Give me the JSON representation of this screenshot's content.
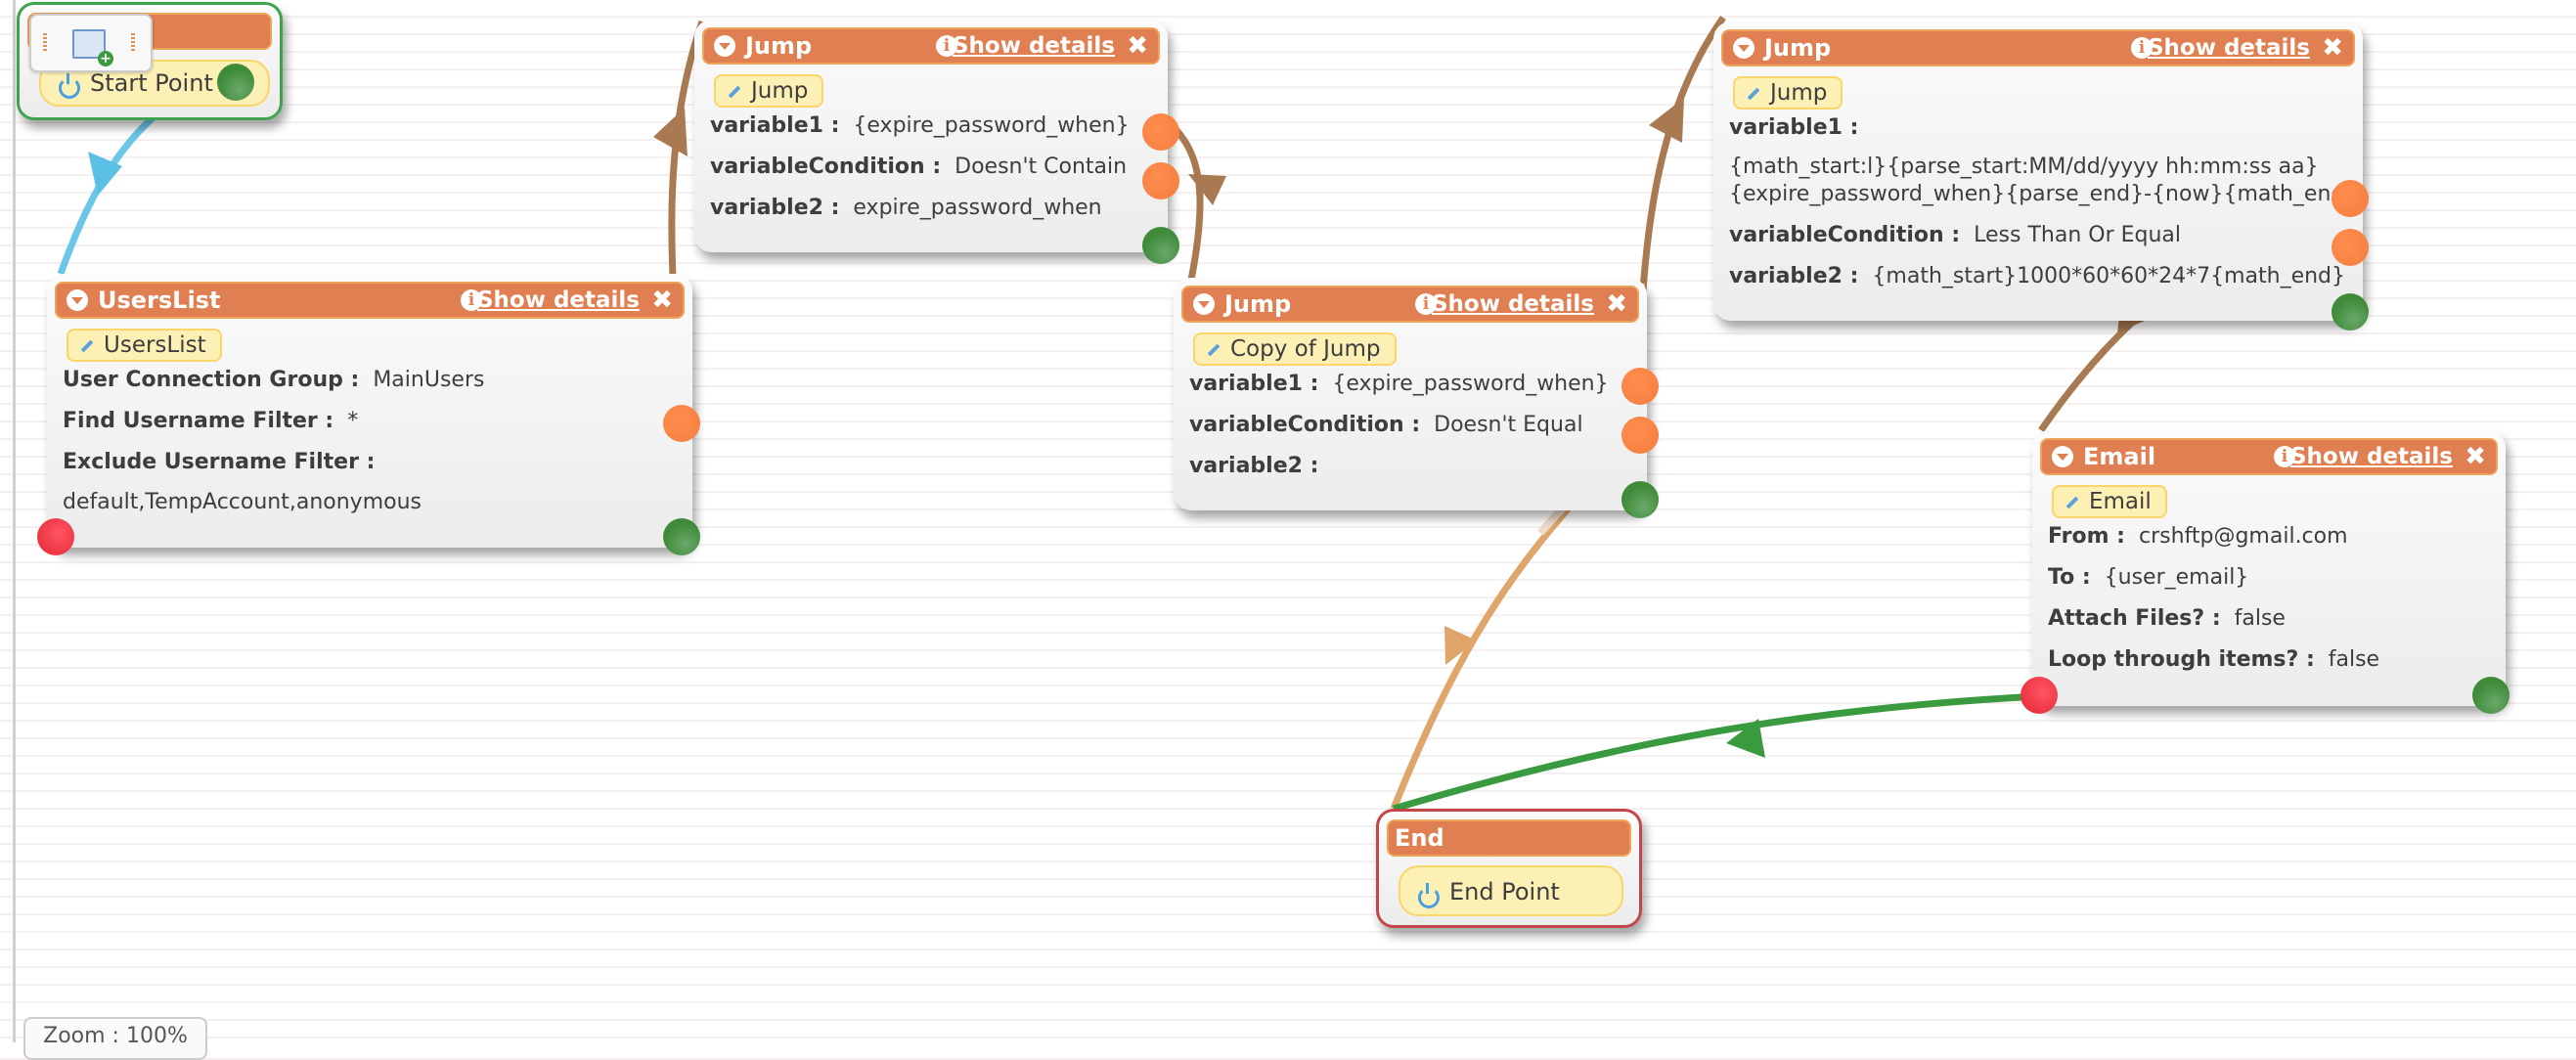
{
  "canvas": {
    "zoom_label": "Zoom : 100%"
  },
  "toolbox": {
    "icon": "add-form-icon"
  },
  "colors": {
    "header": "#df7f52",
    "start_border": "#3fa34d",
    "end_border": "#c0474a",
    "wire_start": "#5bc0e5",
    "wire_jump": "#a97a52",
    "wire_light": "#dfa56a",
    "wire_ok": "#3a9a3f",
    "port_out": "#f47d3e",
    "port_ok": "#3f8b3a",
    "port_err": "#e32636"
  },
  "start_node": {
    "title": "",
    "label": "Start Point",
    "icon": "power-icon"
  },
  "end_node": {
    "title": "End",
    "label": "End Point",
    "icon": "power-icon"
  },
  "nodes": [
    {
      "title": "UsersList",
      "details_label": "Show details",
      "tag": "UsersList",
      "fields": [
        {
          "label": "User Connection Group :",
          "value": "MainUsers"
        },
        {
          "label": "Find Username Filter :",
          "value": "*"
        },
        {
          "label": "Exclude Username Filter :",
          "value": ""
        },
        {
          "label": "",
          "value": "default,TempAccount,anonymous"
        }
      ]
    },
    {
      "title": "Jump",
      "details_label": "Show details",
      "tag": "Jump",
      "fields": [
        {
          "label": "variable1 :",
          "value": "{expire_password_when}"
        },
        {
          "label": "variableCondition :",
          "value": "Doesn't Contain"
        },
        {
          "label": "variable2 :",
          "value": "expire_password_when"
        }
      ]
    },
    {
      "title": "Jump",
      "details_label": "Show details",
      "tag": "Copy of Jump",
      "fields": [
        {
          "label": "variable1 :",
          "value": "{expire_password_when}"
        },
        {
          "label": "variableCondition :",
          "value": "Doesn't Equal"
        },
        {
          "label": "variable2 :",
          "value": ""
        }
      ]
    },
    {
      "title": "Jump",
      "details_label": "Show details",
      "tag": "Jump",
      "fields": [
        {
          "label": "variable1 :",
          "value": ""
        },
        {
          "label": "",
          "value": "{math_start:l}{parse_start:MM/dd/yyyy hh:mm:ss aa}"
        },
        {
          "label": "",
          "value": "{expire_password_when}{parse_end}-{now}{math_end}"
        },
        {
          "label": "variableCondition :",
          "value": "Less Than Or Equal"
        },
        {
          "label": "variable2 :",
          "value": "{math_start}1000*60*60*24*7{math_end}"
        }
      ]
    },
    {
      "title": "Email",
      "details_label": "Show details",
      "tag": "Email",
      "fields": [
        {
          "label": "From :",
          "value": "crshftp@gmail.com"
        },
        {
          "label": "To :",
          "value": "{user_email}"
        },
        {
          "label": "Attach Files? :",
          "value": "false"
        },
        {
          "label": "Loop through items? :",
          "value": "false"
        }
      ]
    }
  ]
}
